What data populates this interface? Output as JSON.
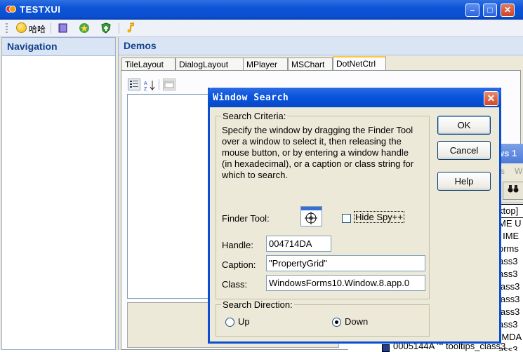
{
  "app": {
    "title": "TESTXUI"
  },
  "toolbar": {
    "button_label": "哈哈"
  },
  "navigation": {
    "header": "Navigation"
  },
  "demos": {
    "header": "Demos",
    "tabs": [
      "TileLayout",
      "DialogLayout",
      "MPlayer",
      "MSChart",
      "DotNetCtrl"
    ],
    "active_tab": "DotNetCtrl"
  },
  "spy_background": {
    "title_fragment": "ws 1",
    "menu_fragments": [
      "s",
      "Wi"
    ],
    "tree_rows": [
      "ktop]",
      "ME U",
      "' IME",
      "orms",
      "ass3",
      "ass3",
      "lass3",
      "lass3",
      "lass3",
      "ass3",
      "(MDA",
      "ass3",
      "ass3"
    ],
    "bottom_row": "0005144A \"\" tooltips_class3"
  },
  "dialog": {
    "title": "Window Search",
    "criteria": {
      "legend": "Search Criteria:",
      "text": "Specify the window by dragging the Finder Tool over a window to select it, then releasing the mouse button, or by entering a window handle (in hexadecimal), or a caption or class string for which to search.",
      "finder_label": "Finder Tool:",
      "hide_spy_label": "Hide Spy++",
      "hide_spy_checked": false,
      "handle_label": "Handle:",
      "handle_value": "004714DA",
      "caption_label": "Caption:",
      "caption_value": "\"PropertyGrid\"",
      "class_label": "Class:",
      "class_value": "WindowsForms10.Window.8.app.0"
    },
    "direction": {
      "legend": "Search Direction:",
      "up_label": "Up",
      "down_label": "Down",
      "selected": "Down"
    },
    "buttons": {
      "ok": "OK",
      "cancel": "Cancel",
      "help": "Help"
    }
  }
}
